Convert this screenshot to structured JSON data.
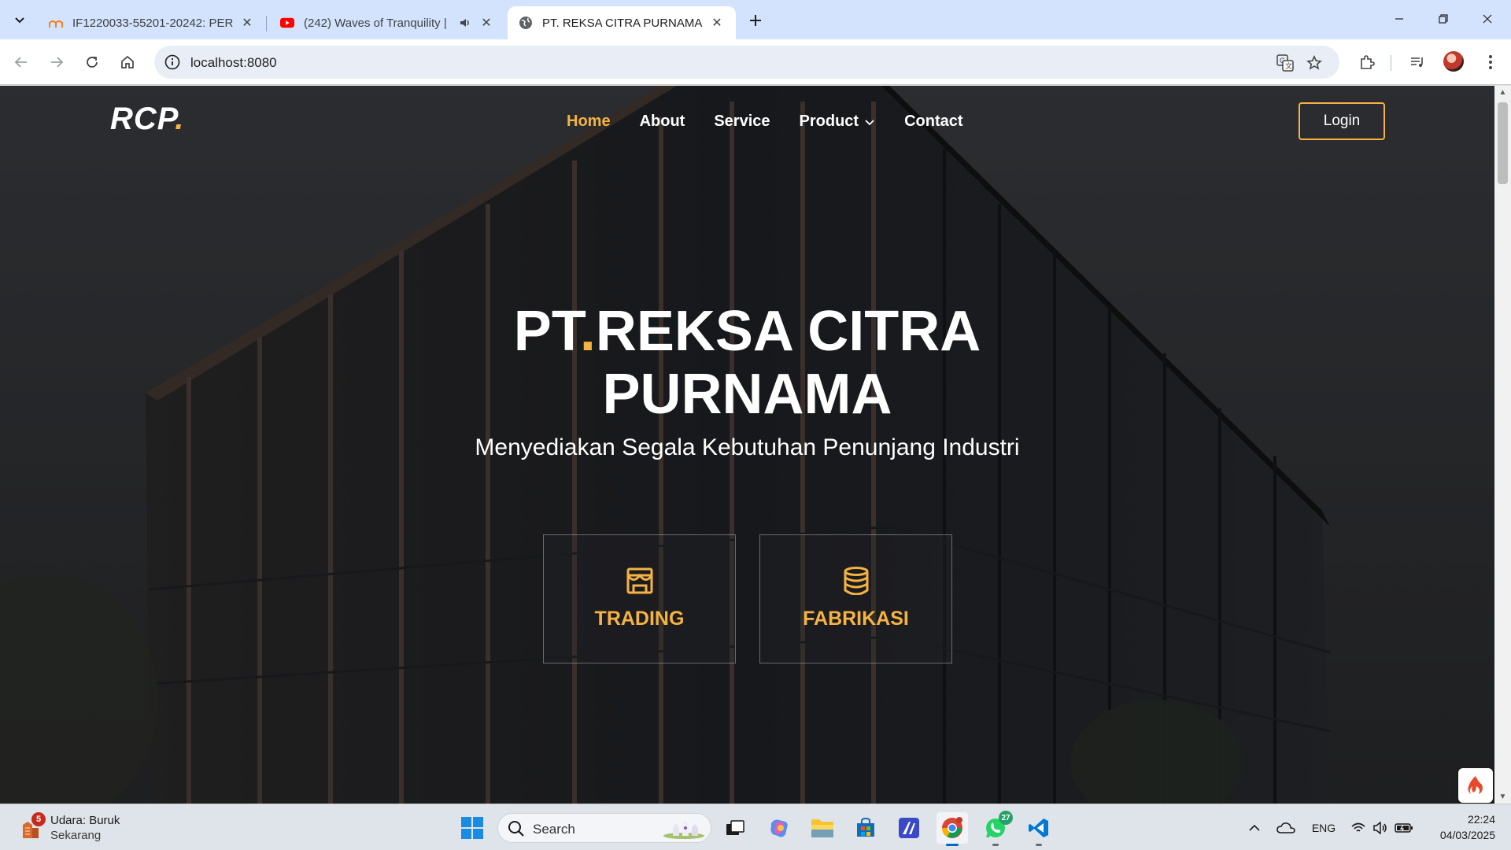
{
  "browser": {
    "tabs": [
      {
        "title": "IF1220033-55201-20242: PERTE",
        "favicon": "moodle-icon",
        "active": false
      },
      {
        "title": "(242) Waves of Tranquility |",
        "favicon": "youtube-icon",
        "active": false,
        "audio": true
      },
      {
        "title": "PT. REKSA CITRA PURNAMA",
        "favicon": "globe-icon",
        "active": true
      }
    ],
    "url": "localhost:8080"
  },
  "site": {
    "logo_text": "RCP",
    "logo_dot": ".",
    "nav": [
      {
        "label": "Home",
        "active": true
      },
      {
        "label": "About",
        "active": false
      },
      {
        "label": "Service",
        "active": false
      },
      {
        "label": "Product",
        "active": false,
        "dropdown": true
      },
      {
        "label": "Contact",
        "active": false
      }
    ],
    "login_label": "Login",
    "hero": {
      "title_part1": "PT",
      "title_dot": ".",
      "title_part2": "REKSA CITRA",
      "title_line2": "PURNAMA",
      "subtitle": "Menyediakan Segala Kebutuhan Penunjang Industri"
    },
    "cards": [
      {
        "label": "TRADING",
        "icon": "shop-icon"
      },
      {
        "label": "FABRIKASI",
        "icon": "database-icon"
      }
    ],
    "accent_color": "#f5b342"
  },
  "taskbar": {
    "weather_title": "Udara: Buruk",
    "weather_sub": "Sekarang",
    "weather_badge": "5",
    "search_placeholder": "Search",
    "whatsapp_badge": "27",
    "language": "ENG",
    "time": "22:24",
    "date": "04/03/2025"
  }
}
